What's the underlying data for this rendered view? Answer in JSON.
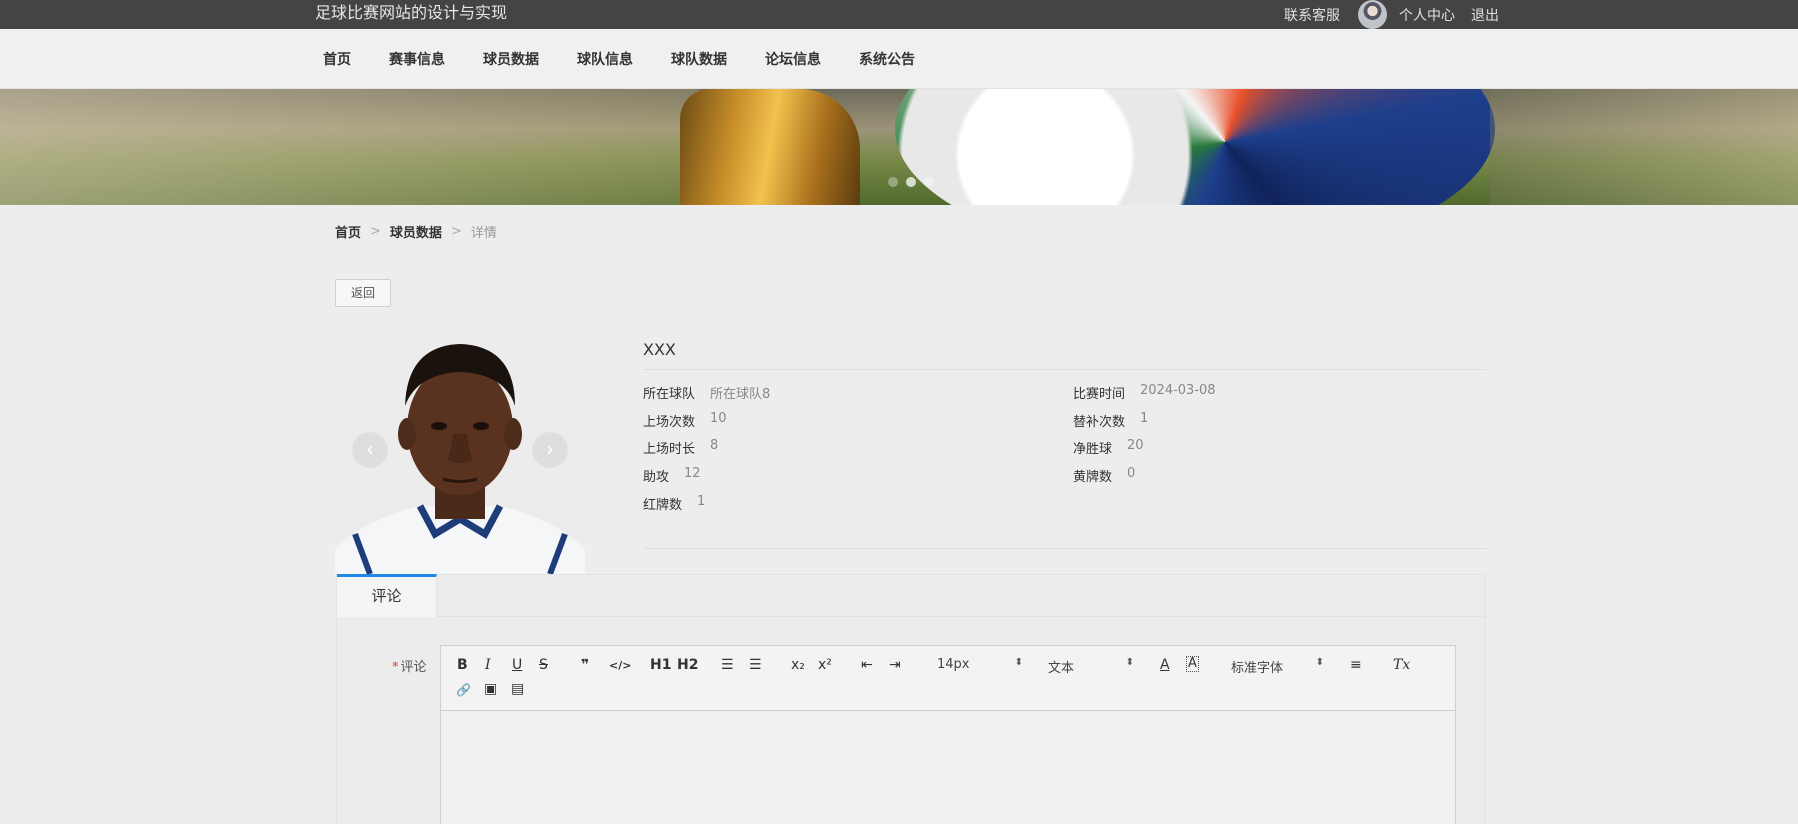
{
  "topbar": {
    "site_title": "足球比赛网站的设计与实现",
    "contact": "联系客服",
    "user_center": "个人中心",
    "logout": "退出"
  },
  "nav": [
    "首页",
    "赛事信息",
    "球员数据",
    "球队信息",
    "球队数据",
    "论坛信息",
    "系统公告"
  ],
  "breadcrumb": {
    "home": "首页",
    "section": "球员数据",
    "current": "详情",
    "separator": ">"
  },
  "back_label": "返回",
  "carousel": {
    "prev": "‹",
    "next": "›"
  },
  "player": {
    "name": "XXX",
    "left": [
      {
        "label": "所在球队",
        "value": "所在球队8"
      },
      {
        "label": "上场次数",
        "value": "10"
      },
      {
        "label": "上场时长",
        "value": "8"
      },
      {
        "label": "助攻",
        "value": "12"
      },
      {
        "label": "红牌数",
        "value": "1"
      }
    ],
    "right": [
      {
        "label": "比赛时间",
        "value": "2024-03-08"
      },
      {
        "label": "替补次数",
        "value": "1"
      },
      {
        "label": "净胜球",
        "value": "20"
      },
      {
        "label": "黄牌数",
        "value": "0"
      }
    ]
  },
  "tab": {
    "label": "评论"
  },
  "comment": {
    "required_mark": "*",
    "label": "评论",
    "toolbar": {
      "bold": "B",
      "italic": "I",
      "underline": "U",
      "strike": "S",
      "quote": "❞",
      "code": "</>",
      "h1": "H1",
      "h2": "H2",
      "ordered_list": "☰",
      "bullet_list": "☰",
      "subscript": "x₂",
      "superscript": "x²",
      "outdent": "⇤",
      "indent": "⇥",
      "font_size": "14px",
      "block_type": "文本",
      "font_color": "A",
      "background_color": "A",
      "font_family": "标准字体",
      "align": "≡",
      "clear_format": "Tx",
      "link": "🔗",
      "image": "▣",
      "video": "▤"
    }
  },
  "colors": {
    "topbar": "#444444",
    "accent": "#1e88e5",
    "required": "#e53935"
  }
}
